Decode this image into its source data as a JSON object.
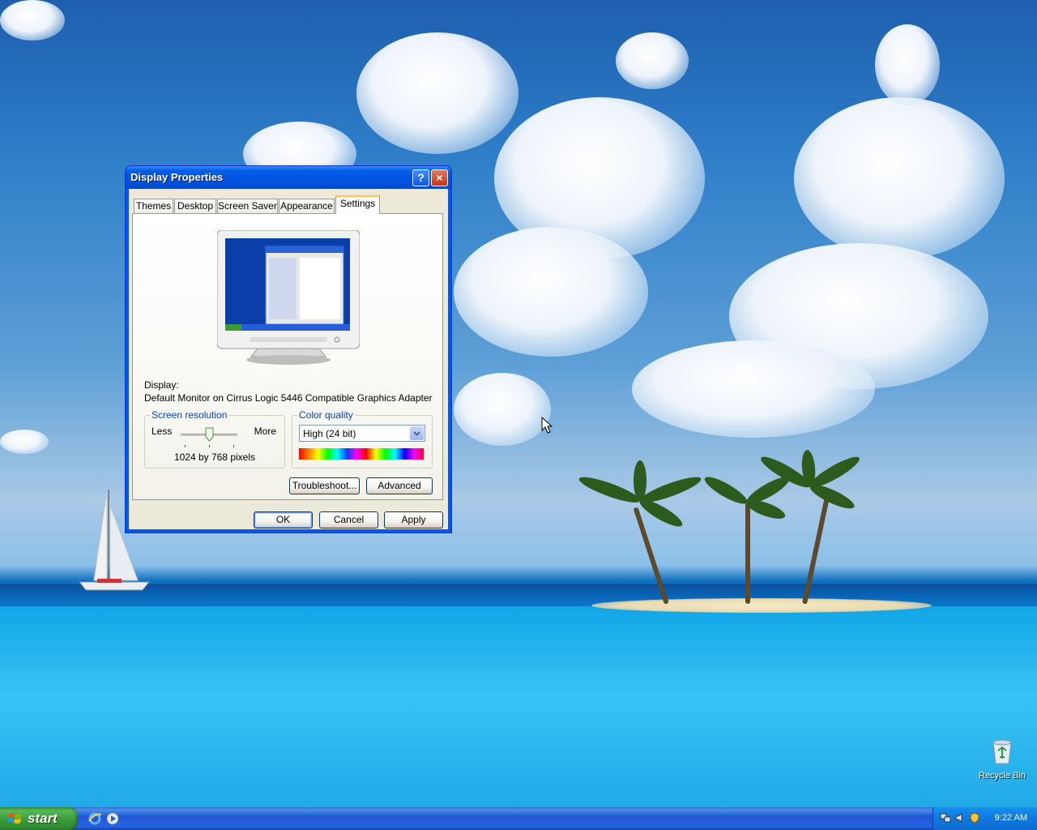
{
  "window": {
    "title": "Display Properties",
    "help_label": "?",
    "close_label": "×",
    "tabs": [
      {
        "label": "Themes",
        "active": false
      },
      {
        "label": "Desktop",
        "active": false
      },
      {
        "label": "Screen Saver",
        "active": false
      },
      {
        "label": "Appearance",
        "active": false
      },
      {
        "label": "Settings",
        "active": true
      }
    ],
    "display_label": "Display:",
    "display_value": "Default Monitor on Cirrus Logic 5446 Compatible Graphics Adapter",
    "screen_resolution": {
      "legend": "Screen resolution",
      "less": "Less",
      "more": "More",
      "value_text": "1024 by 768 pixels"
    },
    "color_quality": {
      "legend": "Color quality",
      "selected": "High (24 bit)"
    },
    "buttons": {
      "troubleshoot": "Troubleshoot...",
      "advanced": "Advanced",
      "ok": "OK",
      "cancel": "Cancel",
      "apply": "Apply"
    }
  },
  "desktop": {
    "icons": [
      {
        "label": "Recycle Bin",
        "icon": "recycle-bin-icon"
      }
    ]
  },
  "taskbar": {
    "start_label": "start",
    "quick_launch": [
      "internet-explorer-icon",
      "media-player-icon"
    ],
    "tray_icons": [
      "network-icon",
      "volume-icon",
      "security-icon"
    ],
    "clock": "9:22 AM"
  },
  "colors": {
    "titlebar": "#0054e3",
    "taskbar": "#245edb",
    "start": "#3a9b3a",
    "dialog_face": "#ece9d8",
    "active_tab_accent": "#ffc83c",
    "groupbox_label": "#0046d5"
  }
}
